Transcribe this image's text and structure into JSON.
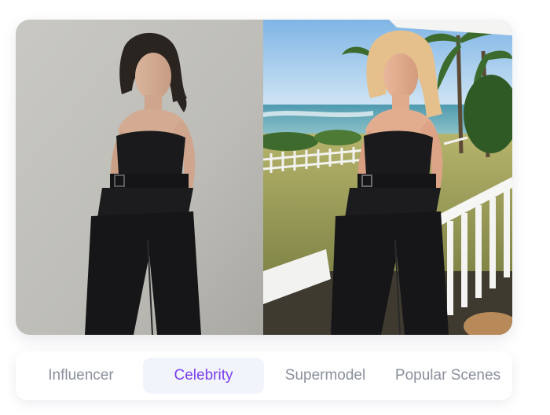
{
  "comparison": {
    "before_image": "original-portrait-photo",
    "after_image": "ai-generated-beach-portrait"
  },
  "tabs": [
    {
      "label": "Influencer",
      "selected": false
    },
    {
      "label": "Celebrity",
      "selected": true
    },
    {
      "label": "Supermodel",
      "selected": false
    },
    {
      "label": "Popular Scenes",
      "selected": false
    }
  ],
  "colors": {
    "selected_tab_text": "#7a3df0",
    "unselected_tab_text": "#8a8f9c",
    "selected_tab_background": "#f1f5fb"
  }
}
